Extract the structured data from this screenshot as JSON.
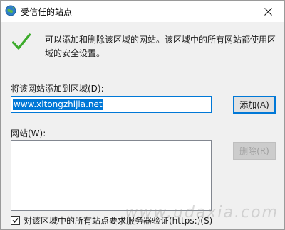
{
  "window": {
    "title": "受信任的站点",
    "title_icon": "globe-icon",
    "close_icon": "close-icon"
  },
  "info": {
    "icon": "checkmark-icon",
    "text": "可以添加和删除该区域的网站。该区域中的所有网站都使用区域的安全设置。"
  },
  "add_section": {
    "label": "将该网站添加到区域(D):",
    "input_value": "www.xitongzhijia.net",
    "add_button": "添加(A)"
  },
  "websites_section": {
    "label": "网站(W):",
    "items": [],
    "remove_button": "删除(R)"
  },
  "https_checkbox": {
    "label": "对该区域中的所有站点要求服务器验证(https:)(S)",
    "checked": true
  },
  "watermark": "www.udaxia.com",
  "colors": {
    "accent": "#0078d7",
    "check_green": "#3cab2b",
    "dialog_bg": "#f0f0f0"
  }
}
